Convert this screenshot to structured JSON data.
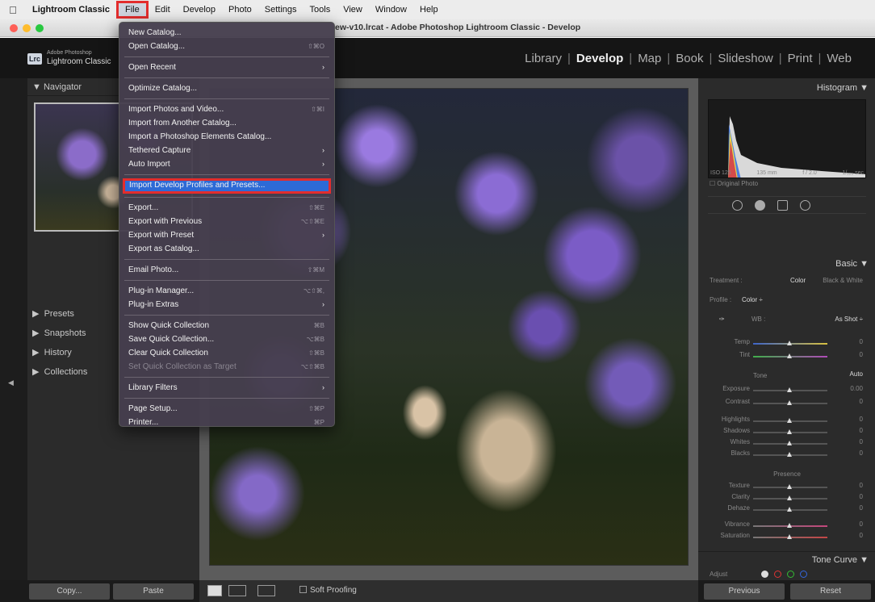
{
  "menubar": {
    "apple_icon": "apple-logo",
    "items": [
      "Lightroom Classic",
      "File",
      "Edit",
      "Develop",
      "Photo",
      "Settings",
      "Tools",
      "View",
      "Window",
      "Help"
    ]
  },
  "window": {
    "title": "ew-v10.lrcat - Adobe Photoshop Lightroom Classic - Develop",
    "traffic_colors": [
      "#fe5f57",
      "#febc2e",
      "#28c840"
    ]
  },
  "identity": {
    "badge": "Lrc",
    "brand_line1": "Adobe Photoshop",
    "brand_line2": "Lightroom Classic",
    "modules": [
      "Library",
      "Develop",
      "Map",
      "Book",
      "Slideshow",
      "Print",
      "Web"
    ],
    "active_module": "Develop"
  },
  "left_panel": {
    "navigator": "Navigator",
    "sections": [
      "Presets",
      "Snapshots",
      "History",
      "Collections"
    ],
    "copy_button": "Copy...",
    "paste_button": "Paste"
  },
  "toolbar": {
    "soft_proofing": "Soft Proofing"
  },
  "right_panel": {
    "histogram": "Histogram",
    "histo_meta": [
      "ISO 125",
      "135 mm",
      "f / 2.0",
      "1/₁₂₅ sec"
    ],
    "original_photo": "Original Photo",
    "basic": "Basic",
    "treatment_label": "Treatment :",
    "treatment_color": "Color",
    "treatment_bw": "Black & White",
    "profile_label": "Profile :",
    "profile_value": "Color ÷",
    "wb_label": "WB :",
    "wb_value": "As Shot ÷",
    "temp": {
      "label": "Temp",
      "value": "0"
    },
    "tint": {
      "label": "Tint",
      "value": "0"
    },
    "tone_label": "Tone",
    "auto": "Auto",
    "exposure": {
      "label": "Exposure",
      "value": "0.00"
    },
    "contrast": {
      "label": "Contrast",
      "value": "0"
    },
    "highlights": {
      "label": "Highlights",
      "value": "0"
    },
    "shadows": {
      "label": "Shadows",
      "value": "0"
    },
    "whites": {
      "label": "Whites",
      "value": "0"
    },
    "blacks": {
      "label": "Blacks",
      "value": "0"
    },
    "presence_label": "Presence",
    "texture": {
      "label": "Texture",
      "value": "0"
    },
    "clarity": {
      "label": "Clarity",
      "value": "0"
    },
    "dehaze": {
      "label": "Dehaze",
      "value": "0"
    },
    "vibrance": {
      "label": "Vibrance",
      "value": "0"
    },
    "saturation": {
      "label": "Saturation",
      "value": "0"
    },
    "tone_curve": "Tone Curve",
    "adjust": "Adjust",
    "previous_button": "Previous",
    "reset_button": "Reset"
  },
  "file_menu": {
    "new_catalog": "New Catalog...",
    "open_catalog": {
      "label": "Open Catalog...",
      "shortcut": "⇧⌘O"
    },
    "open_recent": "Open Recent",
    "optimize_catalog": "Optimize Catalog...",
    "import_photos": {
      "label": "Import Photos and Video...",
      "shortcut": "⇧⌘I"
    },
    "import_another": "Import from Another Catalog...",
    "import_elements": "Import a Photoshop Elements Catalog...",
    "tethered_capture": "Tethered Capture",
    "auto_import": "Auto Import",
    "import_profiles": "Import Develop Profiles and Presets...",
    "export": {
      "label": "Export...",
      "shortcut": "⇧⌘E"
    },
    "export_previous": {
      "label": "Export with Previous",
      "shortcut": "⌥⇧⌘E"
    },
    "export_preset": "Export with Preset",
    "export_catalog": "Export as Catalog...",
    "email_photo": {
      "label": "Email Photo...",
      "shortcut": "⇧⌘M"
    },
    "plugin_manager": {
      "label": "Plug-in Manager...",
      "shortcut": "⌥⇧⌘,"
    },
    "plugin_extras": "Plug-in Extras",
    "show_quick": {
      "label": "Show Quick Collection",
      "shortcut": "⌘B"
    },
    "save_quick": {
      "label": "Save Quick Collection...",
      "shortcut": "⌥⌘B"
    },
    "clear_quick": {
      "label": "Clear Quick Collection",
      "shortcut": "⇧⌘B"
    },
    "set_quick_target": {
      "label": "Set Quick Collection as Target",
      "shortcut": "⌥⇧⌘B"
    },
    "library_filters": "Library Filters",
    "page_setup": {
      "label": "Page Setup...",
      "shortcut": "⇧⌘P"
    },
    "printer": {
      "label": "Printer...",
      "shortcut": "⌘P"
    },
    "submenu_glyph": "›"
  }
}
